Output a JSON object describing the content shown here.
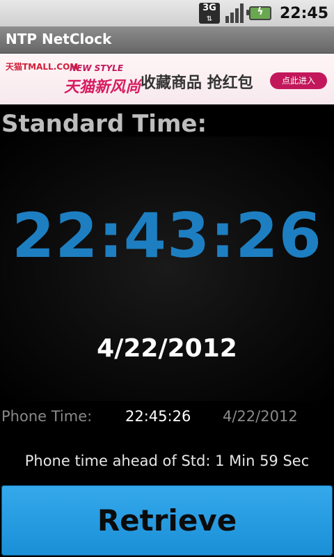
{
  "status_bar": {
    "network": "3G",
    "clock": "22:45",
    "icons": [
      "network-3g-icon",
      "signal-bars-icon",
      "battery-charging-icon"
    ]
  },
  "app": {
    "title": "NTP NetClock"
  },
  "ad": {
    "logo": "天猫TMALL.COM",
    "headline_en": "NEW STYLE",
    "brand": "天猫新风尚",
    "slogan": "收藏商品 抢红包",
    "cta": "点此进入"
  },
  "standard": {
    "label": "Standard Time:",
    "time": "22:43:26",
    "date": "4/22/2012"
  },
  "phone": {
    "label": "Phone Time:",
    "time": "22:45:26",
    "date": "4/22/2012"
  },
  "difference": "Phone time ahead of Std: 1 Min 59 Sec",
  "button": {
    "label": "Retrieve"
  },
  "colors": {
    "time_blue": "#1d7fc1",
    "button_blue": "#2a9fe3",
    "label_gray": "#bdbdbd"
  }
}
